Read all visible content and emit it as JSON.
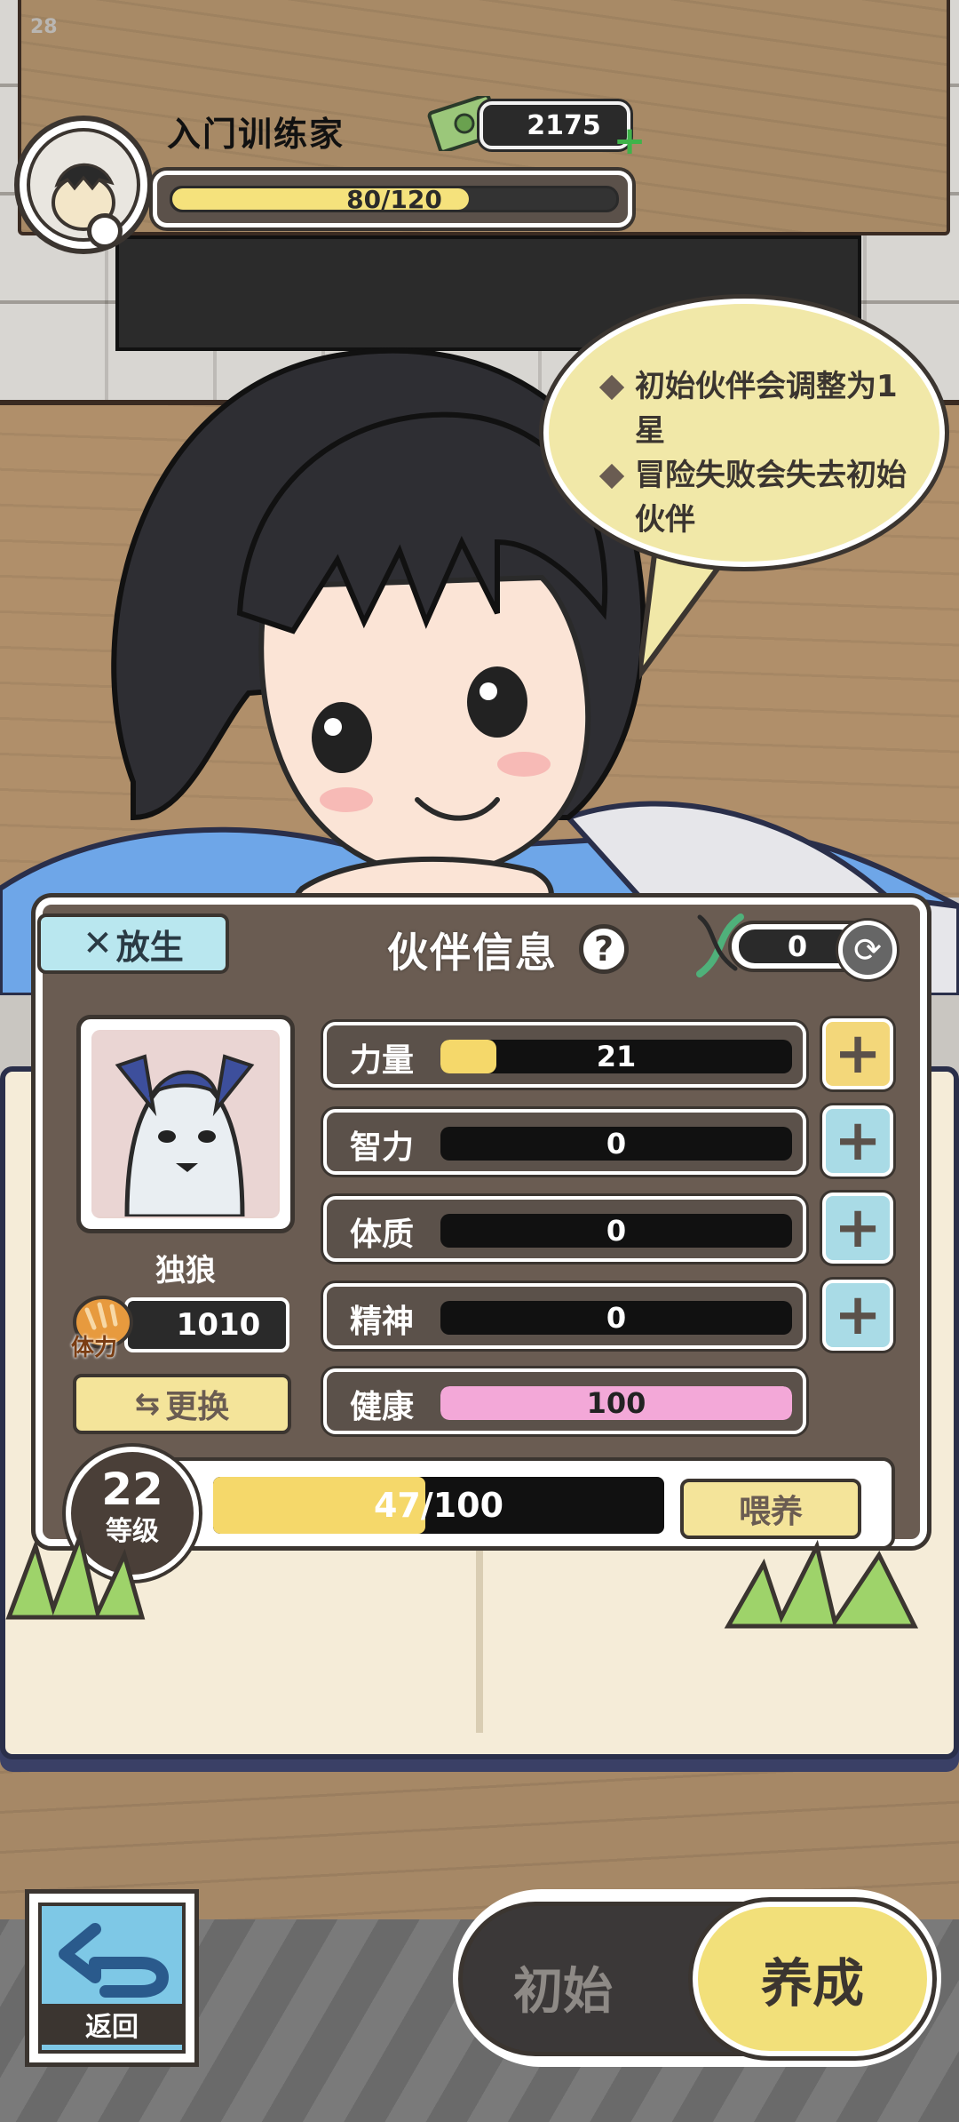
{
  "status": {
    "fps": "28"
  },
  "player": {
    "name": "入门训练家",
    "money": "2175",
    "exp_text": "80/120",
    "exp_fraction": 0.667
  },
  "tips": {
    "lines": [
      "初始伙伴会调整为1星",
      "冒险失败会失去初始伙伴"
    ]
  },
  "panel": {
    "title": "伙伴信息",
    "release_label": "放生",
    "help_glyph": "?",
    "dna_count": "0",
    "pet_name": "独狼",
    "stamina_label": "体力",
    "stamina_value": "1010",
    "swap_label": "更换",
    "stats": [
      {
        "label": "力量",
        "value": "21",
        "fraction": 0.16,
        "color": "#f5d86a",
        "button": "yellow"
      },
      {
        "label": "智力",
        "value": "0",
        "fraction": 0,
        "color": "#a9dbe6",
        "button": "blue"
      },
      {
        "label": "体质",
        "value": "0",
        "fraction": 0,
        "color": "#a9dbe6",
        "button": "blue"
      },
      {
        "label": "精神",
        "value": "0",
        "fraction": 0,
        "color": "#a9dbe6",
        "button": "blue"
      },
      {
        "label": "健康",
        "value": "100",
        "fraction": 1.0,
        "color": "#f3a8d8",
        "button": "none"
      }
    ],
    "level_value": "22",
    "level_label": "等级",
    "level_progress_text": "47/100",
    "level_fraction": 0.47,
    "feed_label": "喂养"
  },
  "bottom": {
    "back_label": "返回",
    "mode_left": "初始",
    "mode_right": "养成"
  },
  "colors": {
    "panel_bg": "#6a5c52",
    "accent_yellow": "#f5d86a",
    "accent_blue": "#a9dbe6",
    "health_pink": "#f3a8d8"
  },
  "icons": [
    "pet-trainer-avatar-icon",
    "money-bill-icon",
    "plus-icon",
    "dna-icon",
    "refresh-icon",
    "bread-icon",
    "swap-arrows-icon",
    "back-arrow-icon"
  ]
}
